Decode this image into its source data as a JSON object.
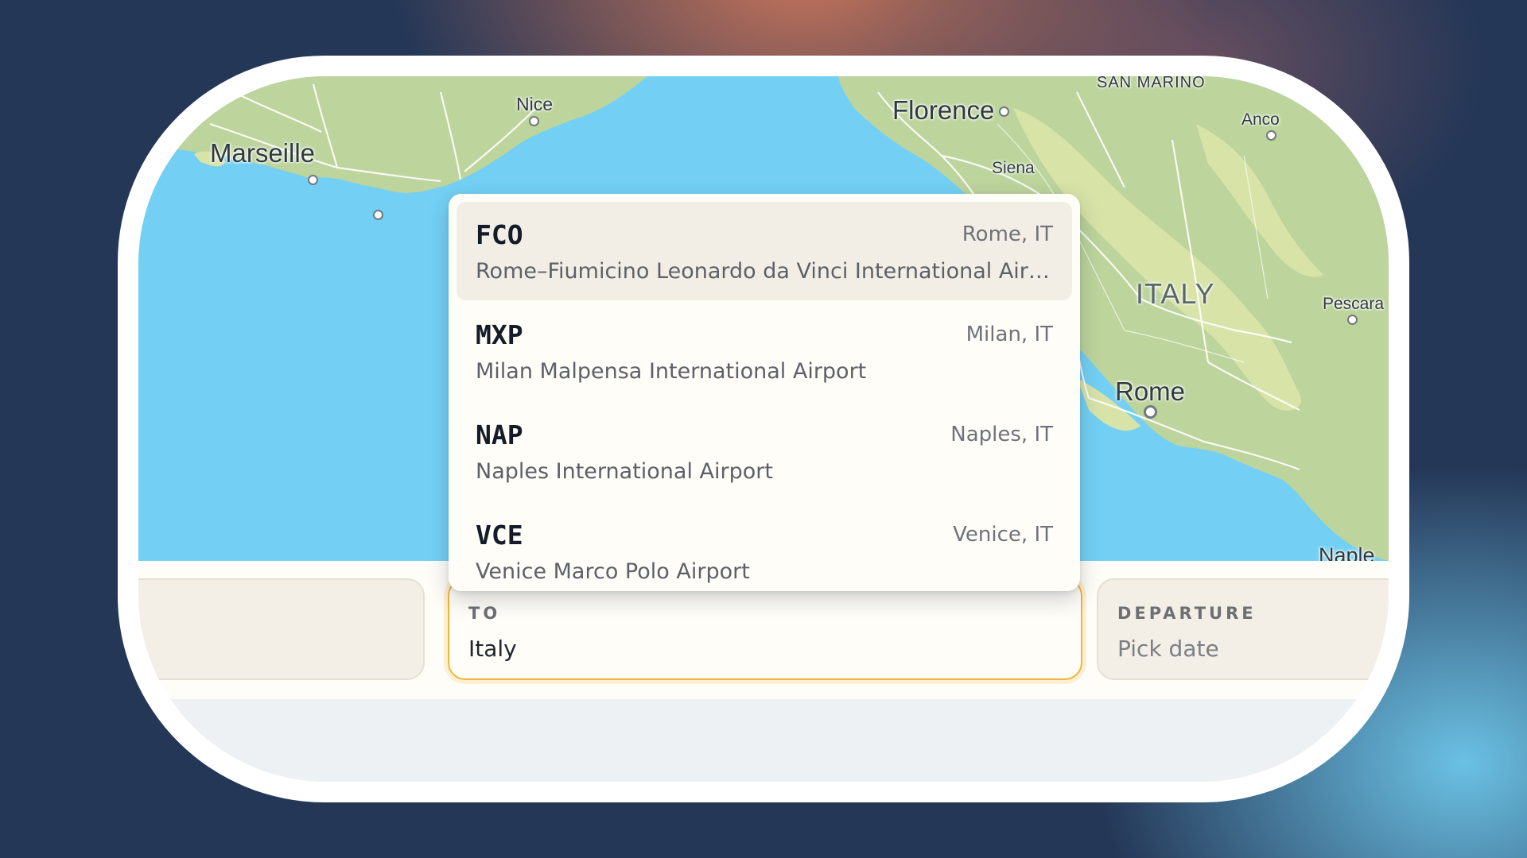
{
  "map": {
    "labels": {
      "marseille": "Marseille",
      "nice": "Nice",
      "florence": "Florence",
      "siena": "Siena",
      "san_marino": "SAN MARINO",
      "ancona": "Anco",
      "italy": "ITALY",
      "pescara": "Pescara",
      "rome": "Rome",
      "naples": "Naple"
    },
    "colors": {
      "sea": "#73d0f4",
      "land": "#bdd49c",
      "hills": "#d8e3a8"
    }
  },
  "dropdown": {
    "options": [
      {
        "code": "FCO",
        "city": "Rome, IT",
        "name": "Rome–Fiumicino Leonardo da Vinci International Airport",
        "selected": true
      },
      {
        "code": "MXP",
        "city": "Milan, IT",
        "name": "Milan Malpensa International Airport",
        "selected": false
      },
      {
        "code": "NAP",
        "city": "Naples, IT",
        "name": "Naples International Airport",
        "selected": false
      },
      {
        "code": "VCE",
        "city": "Venice, IT",
        "name": "Venice Marco Polo Airport",
        "selected": false
      }
    ]
  },
  "search": {
    "to": {
      "label": "TO",
      "value": "Italy"
    },
    "departure": {
      "label": "DEPARTURE",
      "placeholder": "Pick date"
    }
  },
  "colors": {
    "accent": "#f0b43c",
    "background": "#253757"
  }
}
